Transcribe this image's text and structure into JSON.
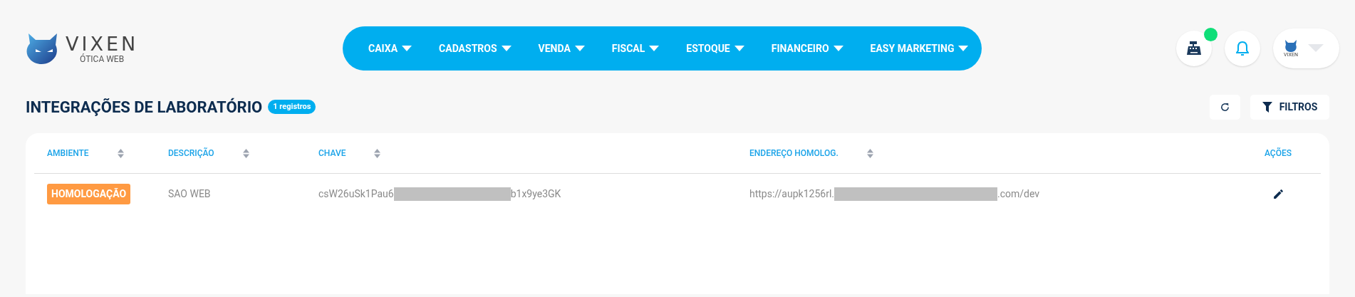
{
  "logo": {
    "name": "VIXEN",
    "tagline": "ÓTICA WEB"
  },
  "nav": [
    {
      "label": "CAIXA"
    },
    {
      "label": "CADASTROS"
    },
    {
      "label": "VENDA"
    },
    {
      "label": "FISCAL"
    },
    {
      "label": "ESTOQUE"
    },
    {
      "label": "FINANCEIRO"
    },
    {
      "label": "EASY MARKETING"
    }
  ],
  "header_actions": {
    "cash_register_online": true,
    "avatar_text": "VIXEN"
  },
  "page": {
    "title": "INTEGRAÇÕES DE LABORATÓRIO",
    "count_badge": "1 registros",
    "filter_button": "FILTROS"
  },
  "table": {
    "columns": [
      {
        "label": "AMBIENTE",
        "sortable": true
      },
      {
        "label": "DESCRIÇÃO",
        "sortable": true
      },
      {
        "label": "CHAVE",
        "sortable": true
      },
      {
        "label": "ENDEREÇO HOMOLOG.",
        "sortable": true
      },
      {
        "label": "AÇÕES",
        "sortable": false
      }
    ],
    "rows": [
      {
        "environment": "HOMOLOGAÇÃO",
        "description": "SAO WEB",
        "key_start": "csW26uSk1Pau6",
        "key_end": "b1x9ye3GK",
        "address_start": "https://aupk1256rl.",
        "address_end": ".com/dev"
      }
    ]
  }
}
